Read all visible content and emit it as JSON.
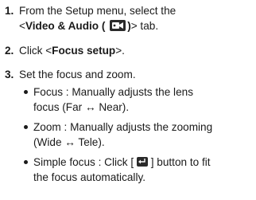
{
  "steps": [
    {
      "number": "1.",
      "line1": "From the Setup menu, select the",
      "line2_open": "<",
      "line2_bold": "Video & Audio (",
      "line2_bold_close": ")",
      "line2_end": "> tab."
    },
    {
      "number": "2.",
      "text_open": "Click <",
      "text_bold": "Focus setup",
      "text_close": ">."
    },
    {
      "number": "3.",
      "text": "Set the focus and zoom."
    }
  ],
  "bullets": [
    {
      "line1": "Focus : Manually adjusts the lens",
      "line2": "focus (Far ↔ Near)."
    },
    {
      "line1": "Zoom : Manually adjusts the zooming",
      "line2": "(Wide ↔ Tele)."
    },
    {
      "line1_pre": "Simple focus : Click [",
      "line1_post": "] button to fit",
      "line2": "the focus automatically."
    }
  ],
  "icons": {
    "video_audio": "video-audio-tab-icon",
    "enter": "enter-key-icon"
  }
}
